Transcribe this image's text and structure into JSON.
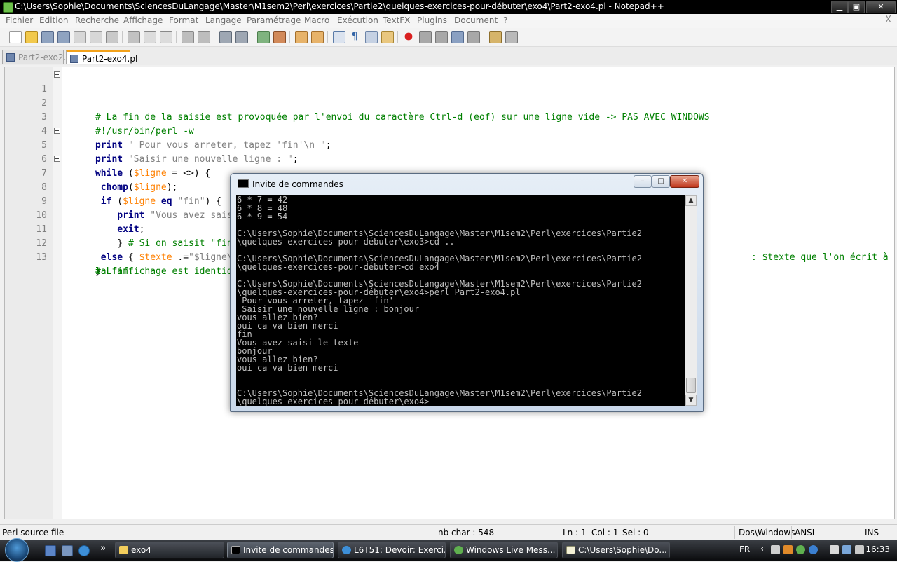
{
  "window": {
    "title": "C:\\Users\\Sophie\\Documents\\SciencesDuLangage\\Master\\M1sem2\\Perl\\exercices\\Partie2\\quelques-exercices-pour-débuter\\exo4\\Part2-exo4.pl - Notepad++",
    "minimize_glyph": "▁",
    "maximize_glyph": "▣",
    "close_glyph": "✕"
  },
  "menu": {
    "items": [
      "Fichier",
      "Edition",
      "Recherche",
      "Affichage",
      "Format",
      "Langage",
      "Paramétrage",
      "Macro",
      "Exécution",
      "TextFX",
      "Plugins",
      "Document",
      "?"
    ],
    "close_glyph": "X"
  },
  "tabs": [
    {
      "label": "Part2-exo2.pl",
      "active": false
    },
    {
      "label": "Part2-exo4.pl",
      "active": true
    }
  ],
  "editor": {
    "line_numbers": [
      "1",
      "2",
      "3",
      "4",
      "5",
      "6",
      "7",
      "8",
      "9",
      "10",
      "11",
      "12",
      "13"
    ],
    "lines": {
      "l1": "# La fin de la saisie est provoquée par l'envoi du caractère Ctrl-d (eof) sur une ligne vide -> PAS AVEC WINDOWS",
      "l2": "#!/usr/bin/perl -w",
      "l3_kw": "print",
      "l3_str": " \" Pour vous arreter, tapez 'fin'\\n \"",
      "l3_end": ";",
      "l4_kw": "print",
      "l4_str": " \"Saisir une nouvelle ligne : \"",
      "l4_end": ";",
      "l5_kw": "while",
      "l5_a": " (",
      "l5_var": "$ligne",
      "l5_b": " = <>) {",
      "l6_kw": " chomp",
      "l6_a": "(",
      "l6_var": "$ligne",
      "l6_b": ");",
      "l7_kw": " if",
      "l7_a": " (",
      "l7_var": "$ligne",
      "l7_kw2": " eq",
      "l7_str": " \"fin\"",
      "l7_b": ") {",
      "l8_kw": "    print",
      "l8_str": " \"Vous avez saisi le texte \\n$texte \\n\"",
      "l8_end": ";",
      "l9_kw": "    exit",
      "l9_end": ";",
      "l10_a": "    } ",
      "l10_cm": "# Si on saisit \"fin\",",
      "l11_kw": " else",
      "l11_a": " { ",
      "l11_var": "$texte",
      "l11_b": " .=",
      "l11_str": "\"$ligne\\n\"",
      "l12": "}",
      "l13_a": "# L'affichage est identique",
      "l13_b": ": $texte que l'on écrit à",
      "l13_c": "la fin."
    }
  },
  "cmd": {
    "title": "Invite de commandes",
    "output": "6 * 7 = 42\n6 * 8 = 48\n6 * 9 = 54\n\nC:\\Users\\Sophie\\Documents\\SciencesDuLangage\\Master\\M1sem2\\Perl\\exercices\\Partie2\n\\quelques-exercices-pour-débuter\\exo3>cd ..\n\nC:\\Users\\Sophie\\Documents\\SciencesDuLangage\\Master\\M1sem2\\Perl\\exercices\\Partie2\n\\quelques-exercices-pour-débuter>cd exo4\n\nC:\\Users\\Sophie\\Documents\\SciencesDuLangage\\Master\\M1sem2\\Perl\\exercices\\Partie2\n\\quelques-exercices-pour-débuter\\exo4>perl Part2-exo4.pl\n Pour vous arreter, tapez 'fin'\n Saisir une nouvelle ligne : bonjour\nvous allez bien?\noui ca va bien merci\nfin\nVous avez saisi le texte\nbonjour\nvous allez bien?\noui ca va bien merci\n\n\nC:\\Users\\Sophie\\Documents\\SciencesDuLangage\\Master\\M1sem2\\Perl\\exercices\\Partie2\n\\quelques-exercices-pour-débuter\\exo4>",
    "minimize_glyph": "–",
    "maximize_glyph": "□",
    "close_glyph": "✕",
    "scroll_up": "▲",
    "scroll_down": "▼"
  },
  "status": {
    "filetype": "Perl source file",
    "nbchar": "nb char : 548",
    "ln": "Ln : 1",
    "col": "Col : 1",
    "sel": "Sel : 0",
    "eol": "Dos\\Windows",
    "encoding": "ANSI",
    "mode": "INS"
  },
  "taskbar": {
    "buttons": [
      {
        "label": "exo4",
        "active": false
      },
      {
        "label": "Invite de commandes",
        "active": true
      },
      {
        "label": "L6T51: Devoir: Exerci...",
        "active": false
      },
      {
        "label": "Windows Live Mess...",
        "active": false
      },
      {
        "label": "C:\\Users\\Sophie\\Do...",
        "active": false
      }
    ],
    "quicklaunch_more": "»",
    "lang": "FR",
    "tray_arrow": "‹",
    "clock": "16:33"
  },
  "colors": {
    "comment": "#008000",
    "keyword": "#000080",
    "string": "#808080",
    "variable": "#ff8000",
    "active_tab_accent": "#f3a21b"
  }
}
